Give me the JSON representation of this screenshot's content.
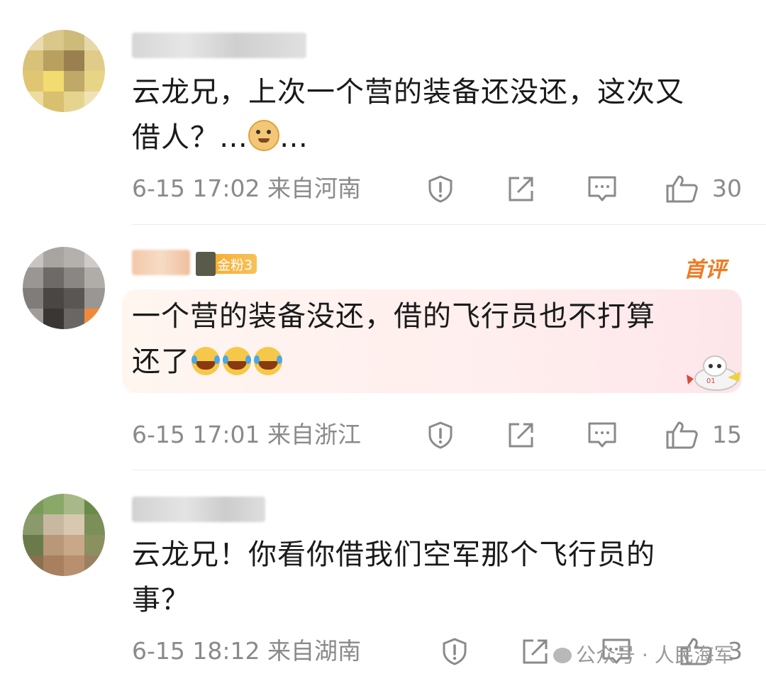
{
  "comments": [
    {
      "text_line1": "云龙兄，上次一个营的装备还没还，这次又",
      "text_line2": "借人？…",
      "text_suffix": "…",
      "time": "6-15 17:02 来自河南",
      "likes": "30"
    },
    {
      "badge": "金粉3",
      "tag": "首评",
      "text_line1": "一个营的装备没还，借的飞行员也不打算",
      "text_line2": "还了",
      "time": "6-15 17:01 来自浙江",
      "likes": "15"
    },
    {
      "text_line1": "云龙兄！你看你借我们空军那个飞行员的",
      "text_line2": "事？",
      "time": "6-15 18:12 来自湖南",
      "likes": "3"
    }
  ],
  "watermark": "公众号 · 人民海军",
  "icons": {
    "report": "report-icon",
    "share": "share-icon",
    "reply": "comment-icon",
    "like": "thumbs-up-icon"
  },
  "colors": {
    "meta_text": "#8a8a8a",
    "first_tag": "#f07a22",
    "badge": "#f6a623"
  }
}
